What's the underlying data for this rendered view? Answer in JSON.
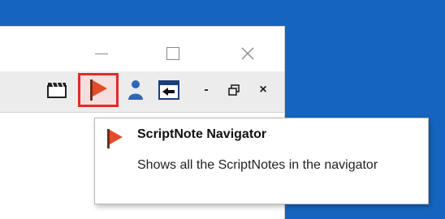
{
  "tooltip": {
    "title": "ScriptNote Navigator",
    "description": "Shows all the ScriptNotes in the navigator"
  },
  "toolbar": {
    "icons": [
      "clapperboard-icon",
      "scriptnote-flag-icon",
      "person-icon",
      "import-arrow-icon"
    ],
    "controls": {
      "minimize": "-",
      "restore": "🗗",
      "close": "×"
    }
  },
  "colors": {
    "desktop": "#1565c0",
    "flag": "#e24c2a",
    "selection_border": "#e12b2b",
    "person": "#2f66b8"
  }
}
